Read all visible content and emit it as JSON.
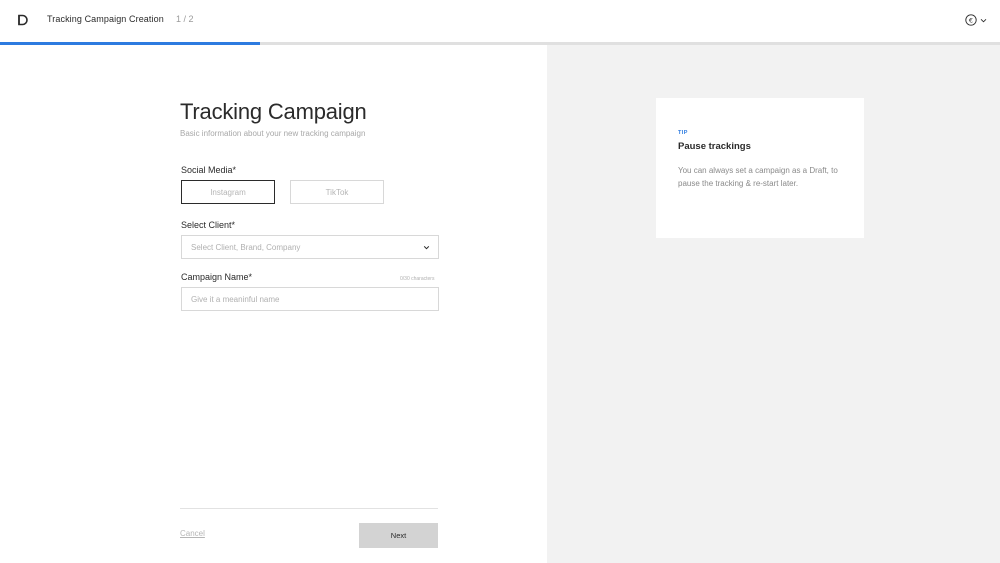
{
  "header": {
    "logo_icon": "logo-d-icon",
    "title": "Tracking Campaign Creation",
    "step": "1 / 2",
    "account_icon": "currency-euro-icon",
    "account_chevron_icon": "chevron-down-icon",
    "progress_fraction": 0.26,
    "progress_color": "#2d7be0"
  },
  "form": {
    "heading": "Tracking Campaign",
    "subheading": "Basic information about your new tracking campaign",
    "social_media": {
      "label": "Social Media*",
      "options": [
        "Instagram",
        "TikTok"
      ],
      "selected": "Instagram"
    },
    "client": {
      "label": "Select Client*",
      "placeholder": "Select Client, Brand, Company",
      "chevron_icon": "chevron-down-icon"
    },
    "campaign_name": {
      "label": "Campaign Name*",
      "counter": "0/30 characters",
      "placeholder": "Give it a meaninful name",
      "value": ""
    },
    "actions": {
      "cancel_label": "Cancel",
      "next_label": "Next"
    }
  },
  "tip": {
    "tag": "TIP",
    "title": "Pause trackings",
    "body": "You can always set a campaign as a Draft, to pause the tracking & re-start later."
  },
  "colors": {
    "accent": "#2d7be0",
    "panel_bg": "#f2f2f2",
    "next_button_bg": "#d3d3d3"
  }
}
